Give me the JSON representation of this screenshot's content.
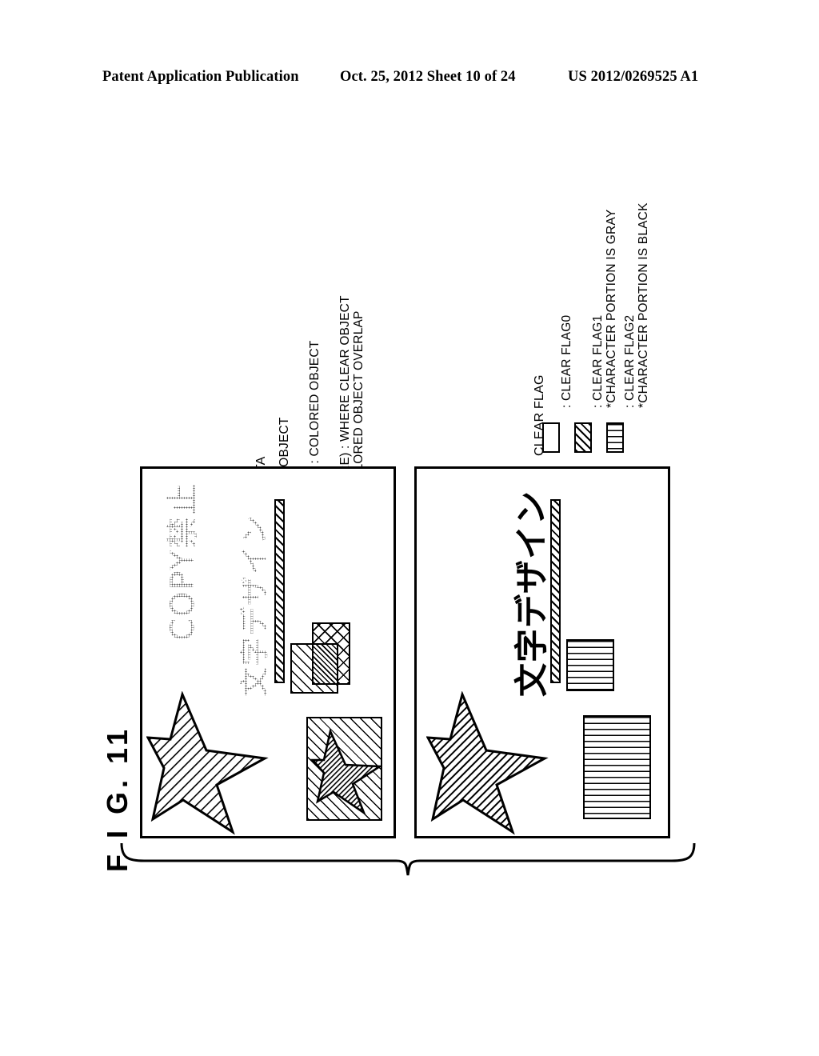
{
  "header": {
    "publication": "Patent Application Publication",
    "date_sheet": "Oct. 25, 2012   Sheet 10 of 24",
    "doc_number": "US 2012/0269525 A1"
  },
  "figure": {
    "label": "F I G.  11"
  },
  "legends": [
    {
      "id": "document-data",
      "title": "DOCUMENT DATA",
      "entries": [
        {
          "swatch": "diagonal-line-swatch",
          "text": ": CLEAR OBJECT"
        },
        {
          "swatch": "cross-hatch-swatch",
          "text": "(CHECK) : COLORED OBJECT"
        },
        {
          "swatch": "dense-diagonal-swatch",
          "text": "(TEXTURE) : WHERE CLEAR OBJECT",
          "text2": "AND COLORED OBJECT OVERLAP"
        }
      ]
    },
    {
      "id": "clear-flag",
      "title": "CLEAR FLAG",
      "entries": [
        {
          "swatch": "white-swatch",
          "text": ": CLEAR FLAG0"
        },
        {
          "swatch": "diagonal-stripe-swatch",
          "text": ": CLEAR FLAG1",
          "text2": "*CHARACTER PORTION IS GRAY"
        },
        {
          "swatch": "horizontal-stripe-swatch",
          "text": ": CLEAR FLAG2",
          "text2": "*CHARACTER PORTION IS BLACK"
        }
      ]
    }
  ],
  "panels": {
    "left": {
      "id": "document-data-panel",
      "watermark_text": "COPY禁止",
      "design_text": "文字デザイン"
    },
    "right": {
      "id": "clear-flag-panel",
      "design_text": "文字デザイン"
    }
  }
}
